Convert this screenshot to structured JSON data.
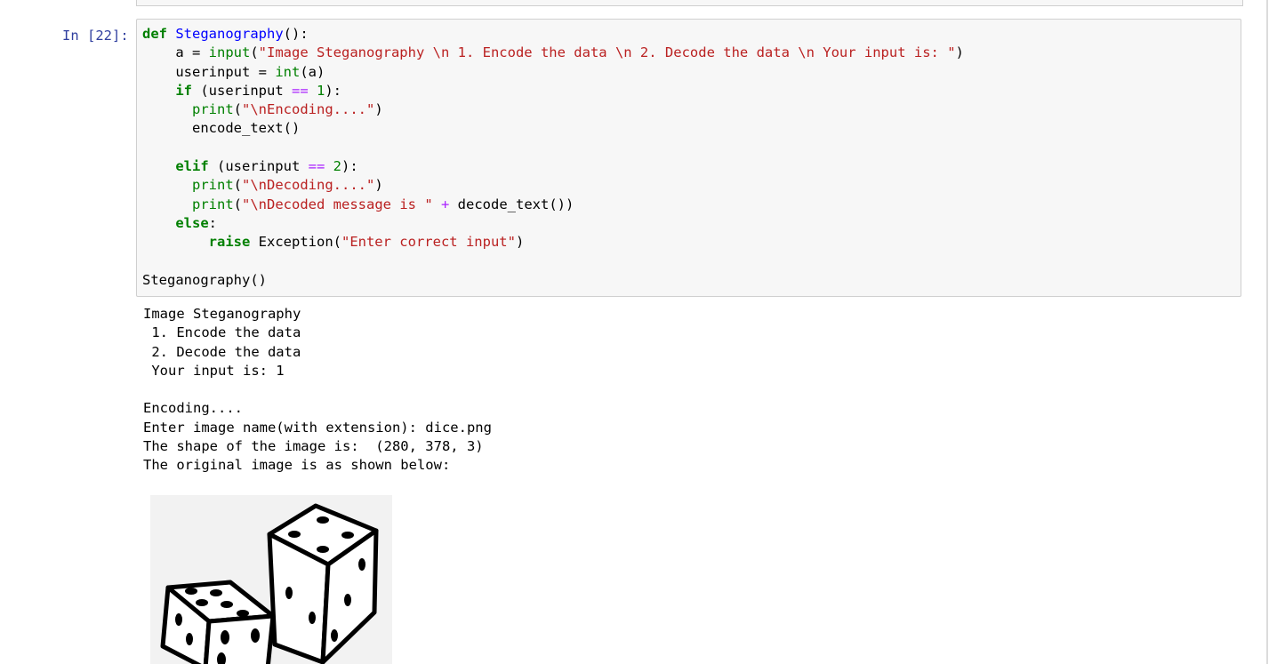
{
  "cell": {
    "prompt": "In [22]:",
    "code": {
      "l1": {
        "kw": "def",
        "fn": "Steganography",
        "rest": "():"
      },
      "l2": {
        "pre": "    a = ",
        "bi": "input",
        "s1": "(",
        "str": "\"Image Steganography \\n 1. Encode the data \\n 2. Decode the data \\n Your input is: \"",
        "s2": ")"
      },
      "l3": {
        "pre": "    userinput = ",
        "bi": "int",
        "rest": "(a)"
      },
      "l4": {
        "pre": "    ",
        "kw": "if",
        "a": " (userinput ",
        "op": "==",
        "sp": " ",
        "num": "1",
        "rest": "):"
      },
      "l5": {
        "pre": "      ",
        "bi": "print",
        "s1": "(",
        "str": "\"\\nEncoding....\"",
        "s2": ")"
      },
      "l6": {
        "text": "      encode_text()"
      },
      "l8": {
        "pre": "    ",
        "kw": "elif",
        "a": " (userinput ",
        "op": "==",
        "sp": " ",
        "num": "2",
        "rest": "):"
      },
      "l9": {
        "pre": "      ",
        "bi": "print",
        "s1": "(",
        "str": "\"\\nDecoding....\"",
        "s2": ")"
      },
      "l10": {
        "pre": "      ",
        "bi": "print",
        "s1": "(",
        "str": "\"\\nDecoded message is \"",
        "sp": " ",
        "op": "+",
        "rest": " decode_text())"
      },
      "l11": {
        "pre": "    ",
        "kw": "else",
        "rest": ":"
      },
      "l12": {
        "pre": "        ",
        "kw": "raise",
        "a": " Exception(",
        "str": "\"Enter correct input\"",
        "rest": ")"
      },
      "l14": {
        "text": "Steganography()"
      }
    },
    "output": {
      "lines": [
        "Image Steganography",
        " 1. Encode the data",
        " 2. Decode the data",
        " Your input is: 1",
        "",
        "Encoding....",
        "Enter image name(with extension): dice.png",
        "The shape of the image is:  (280, 378, 3)",
        "The original image is as shown below:"
      ]
    },
    "image": {
      "icon": "dice-image"
    }
  }
}
